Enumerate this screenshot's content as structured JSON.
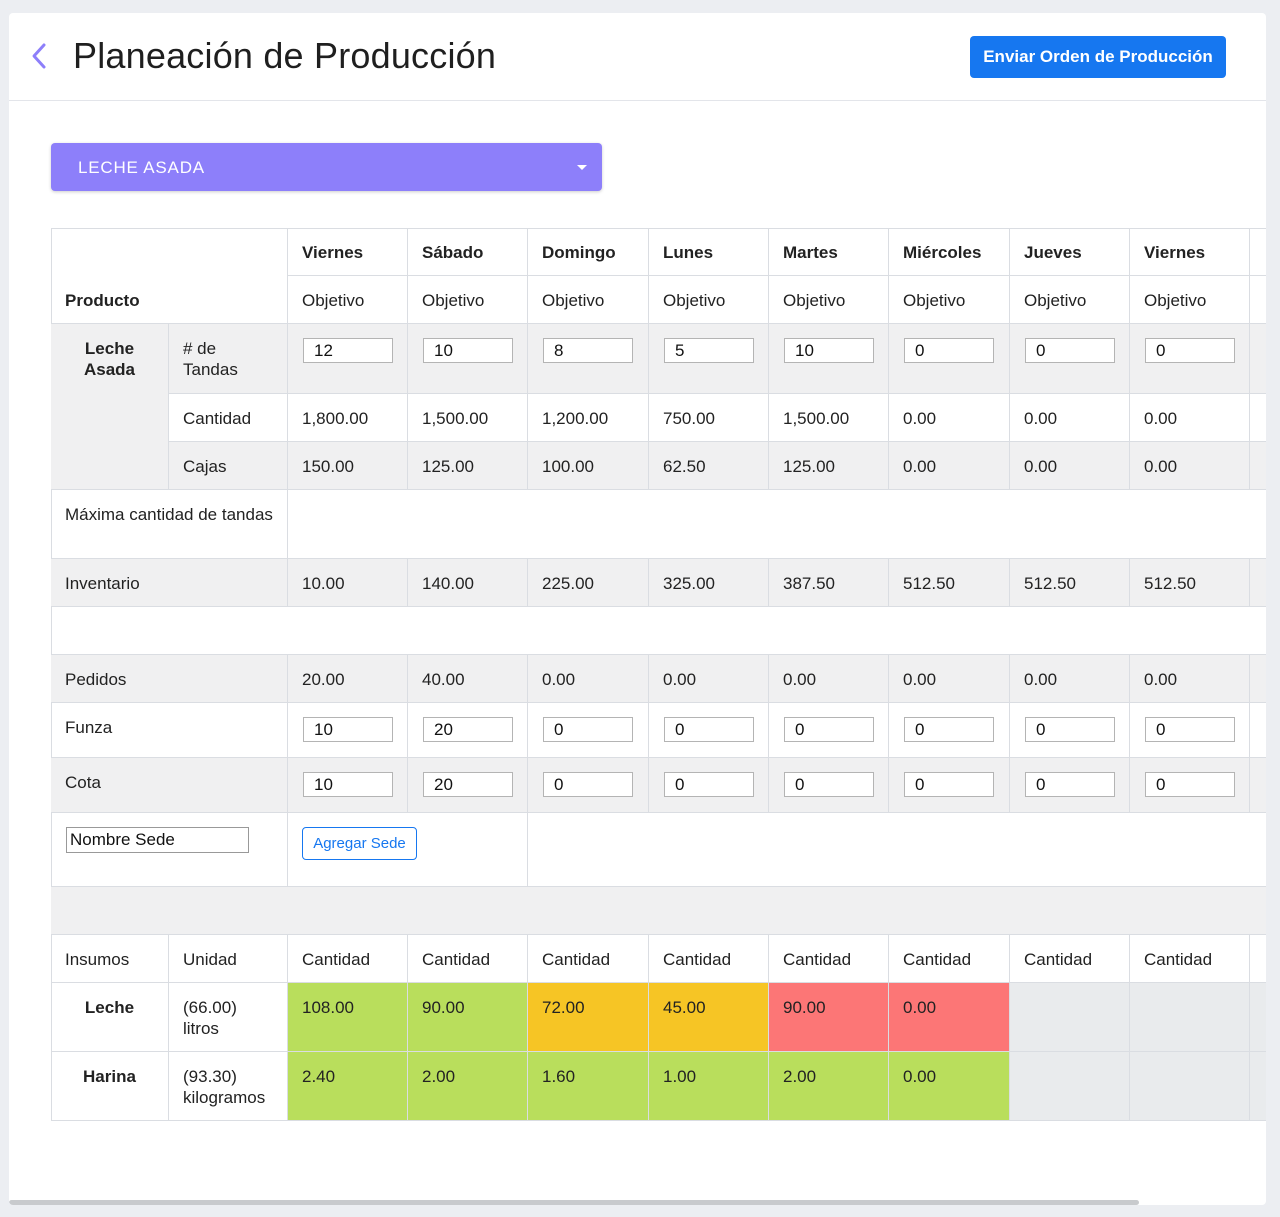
{
  "header": {
    "title": "Planeación de Producción",
    "send_button": "Enviar Orden de Producción"
  },
  "selector": {
    "value": "LECHE ASADA"
  },
  "table": {
    "product_header": "Producto",
    "objective_label": "Objetivo",
    "days": [
      "Viernes",
      "Sábado",
      "Domingo",
      "Lunes",
      "Martes",
      "Miércoles",
      "Jueves",
      "Viernes"
    ],
    "product_name": "Leche Asada",
    "tandas_label": "# de Tandas",
    "tandas": [
      "12",
      "10",
      "8",
      "5",
      "10",
      "0",
      "0",
      "0"
    ],
    "cantidad_label": "Cantidad",
    "cantidad": [
      "1,800.00",
      "1,500.00",
      "1,200.00",
      "750.00",
      "1,500.00",
      "0.00",
      "0.00",
      "0.00"
    ],
    "cajas_label": "Cajas",
    "cajas": [
      "150.00",
      "125.00",
      "100.00",
      "62.50",
      "125.00",
      "0.00",
      "0.00",
      "0.00"
    ],
    "max_label": "Máxima cantidad de tandas",
    "inventario_label": "Inventario",
    "inventario": [
      "10.00",
      "140.00",
      "225.00",
      "325.00",
      "387.50",
      "512.50",
      "512.50",
      "512.50"
    ],
    "pedidos_label": "Pedidos",
    "pedidos": [
      "20.00",
      "40.00",
      "0.00",
      "0.00",
      "0.00",
      "0.00",
      "0.00",
      "0.00"
    ],
    "sedes": [
      {
        "name": "Funza",
        "values": [
          "10",
          "20",
          "0",
          "0",
          "0",
          "0",
          "0",
          "0"
        ]
      },
      {
        "name": "Cota",
        "values": [
          "10",
          "20",
          "0",
          "0",
          "0",
          "0",
          "0",
          "0"
        ]
      }
    ],
    "sede_placeholder": "Nombre Sede",
    "add_sede_button": "Agregar Sede",
    "insumos_header": "Insumos",
    "unidad_header": "Unidad",
    "cantidad_header": "Cantidad",
    "insumos": [
      {
        "name": "Leche",
        "unit": "(66.00) litros",
        "values": [
          "108.00",
          "90.00",
          "72.00",
          "45.00",
          "90.00",
          "0.00",
          "",
          ""
        ],
        "status": [
          "green",
          "green",
          "orange",
          "orange",
          "red",
          "red",
          "empty",
          "empty"
        ]
      },
      {
        "name": "Harina",
        "unit": "(93.30) kilogramos",
        "values": [
          "2.40",
          "2.00",
          "1.60",
          "1.00",
          "2.00",
          "0.00",
          "",
          ""
        ],
        "status": [
          "green",
          "green",
          "green",
          "green",
          "green",
          "green",
          "empty",
          "empty"
        ]
      }
    ]
  },
  "colors": {
    "primary": "#1677f0",
    "selector": "#8d7ffa",
    "green": "#b9de5c",
    "orange": "#f6c525",
    "red": "#fc7676",
    "row_gray": "#f0f0f1"
  }
}
